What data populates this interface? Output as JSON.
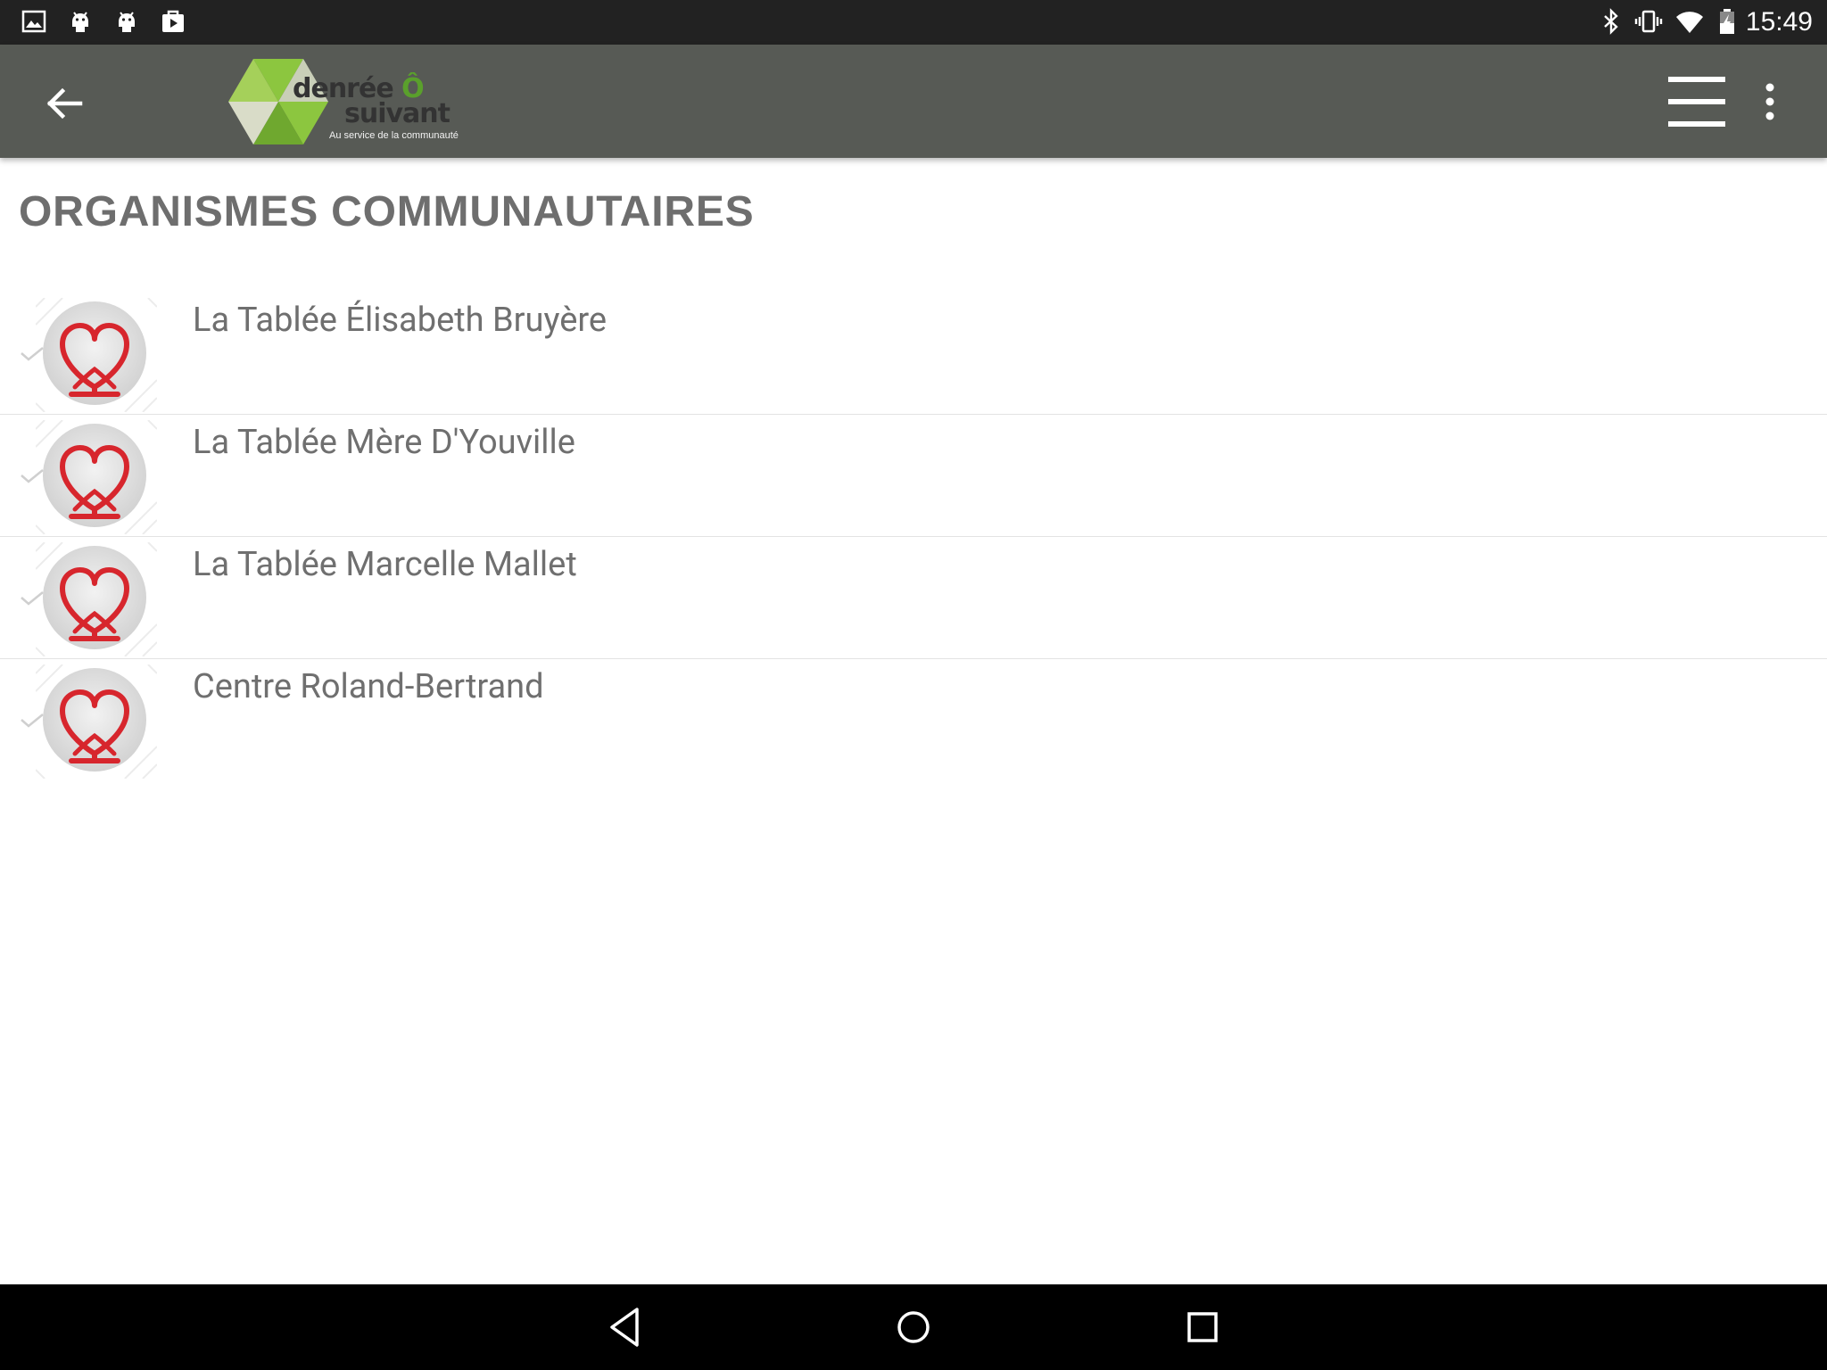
{
  "status_bar": {
    "time": "15:49",
    "left_icons": [
      "image-icon",
      "android-icon",
      "android-icon",
      "play-store-icon"
    ],
    "right_icons": [
      "bluetooth-icon",
      "vibrate-icon",
      "wifi-icon",
      "battery-charging-icon"
    ]
  },
  "toolbar": {
    "logo": {
      "line1": "denrée",
      "accent": "Ô",
      "line2": "suivant",
      "tagline": "Au service de la communauté"
    }
  },
  "page": {
    "title": "ORGANISMES COMMUNAUTAIRES"
  },
  "organizations": [
    {
      "name": "La Tablée Élisabeth Bruyère"
    },
    {
      "name": "La Tablée Mère D'Youville"
    },
    {
      "name": "La Tablée Marcelle Mallet"
    },
    {
      "name": "Centre Roland-Bertrand"
    }
  ],
  "colors": {
    "status_bar": "#222222",
    "toolbar": "#575a55",
    "title": "#6e6e6e",
    "item_text": "#6f6f6f",
    "heart": "#d7262d",
    "logo_green": "#8cc63f",
    "nav_bar": "#000000"
  }
}
